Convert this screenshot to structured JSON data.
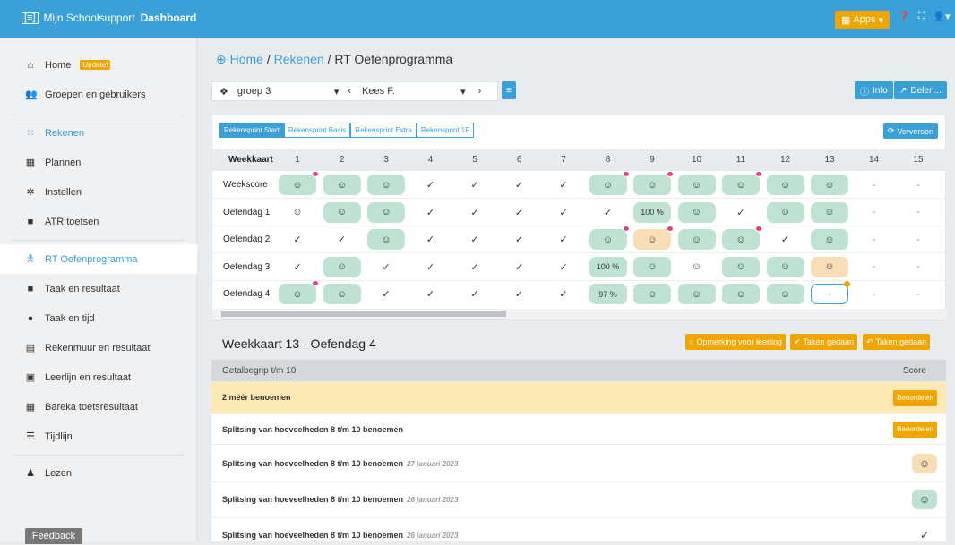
{
  "app": {
    "logo_text": "[≡]",
    "title_prefix": "Mijn Schoolsupport",
    "title_bold": "Dashboard",
    "apps_label": "Apps"
  },
  "sidebar": {
    "items": [
      {
        "label": "Home",
        "badge": "Update!",
        "icon": "home-icon"
      },
      {
        "label": "Groepen en gebruikers",
        "icon": "users-icon"
      },
      {
        "label": "Rekenen",
        "icon": "grid-dots-icon"
      },
      {
        "label": "Plannen",
        "icon": "calendar-icon"
      },
      {
        "label": "Instellen",
        "icon": "gear-icon"
      },
      {
        "label": "ATR toetsen",
        "icon": "box-icon"
      },
      {
        "label": "RT Oefenprogramma",
        "icon": "person-icon"
      },
      {
        "label": "Taak en resultaat",
        "icon": "box-icon"
      },
      {
        "label": "Taak en tijd",
        "icon": "bomb-icon"
      },
      {
        "label": "Rekenmuur en resultaat",
        "icon": "wall-icon"
      },
      {
        "label": "Leerlijn en resultaat",
        "icon": "calendar-check-icon"
      },
      {
        "label": "Bareka toetsresultaat",
        "icon": "table-icon"
      },
      {
        "label": "Tijdlijn",
        "icon": "bars-icon"
      },
      {
        "label": "Lezen",
        "icon": "reader-icon"
      }
    ],
    "feedback": "Feedback"
  },
  "breadcrumb": {
    "home": "Home",
    "sep1": "/",
    "rekenen": "Rekenen",
    "sep2": "/",
    "current": "RT Oefenprogramma"
  },
  "toolbar": {
    "group": "groep 3",
    "student": "Kees F.",
    "info": "Info",
    "share": "Delen..."
  },
  "tabs": [
    "Rekensprint Start",
    "Rekensprint Basis",
    "Rekensprint Extra",
    "Rekensprint 1F"
  ],
  "refresh_label": "Verversen",
  "grid": {
    "header_label": "Weekkaart",
    "weeks": [
      "1",
      "2",
      "3",
      "4",
      "5",
      "6",
      "7",
      "8",
      "9",
      "10",
      "11",
      "12",
      "13",
      "14",
      "15"
    ],
    "rows": [
      {
        "label": "Weekscore",
        "cells": [
          "☺g*",
          "☺g",
          "☺g",
          "✓",
          "✓",
          "✓",
          "✓",
          "☺g*",
          "☺g*",
          "☺g",
          "☺g*",
          "☺g",
          "☺g",
          "-",
          "-"
        ]
      },
      {
        "label": "Oefendag 1",
        "cells": [
          "☺",
          "☺g",
          "☺g",
          "✓",
          "✓",
          "✓",
          "✓",
          "✓",
          "100 %g",
          "☺g",
          "✓",
          "☺g",
          "☺g",
          "-",
          "-"
        ]
      },
      {
        "label": "Oefendag 2",
        "cells": [
          "✓",
          "✓",
          "☺g",
          "✓",
          "✓",
          "✓",
          "✓",
          "☺g*",
          "☺o*",
          "☺g",
          "☺g*",
          "✓",
          "☺g",
          "-",
          "-"
        ]
      },
      {
        "label": "Oefendag 3",
        "cells": [
          "✓",
          "☺g",
          "✓",
          "✓",
          "✓",
          "✓",
          "✓",
          "100 %g",
          "☺g",
          "☺",
          "☺g",
          "☺g",
          "☺o",
          "-",
          "-"
        ]
      },
      {
        "label": "Oefendag 4",
        "cells": [
          "☺g*",
          "☺g",
          "✓",
          "✓",
          "✓",
          "✓",
          "✓",
          "97 %g",
          "☺g",
          "☺g",
          "☺g",
          "☺g",
          "-b",
          "-",
          "-"
        ]
      }
    ]
  },
  "detail": {
    "title": "Weekkaart 13 - Oefendag 4",
    "btn_comment": "Opmerking voor leerling",
    "btn_done": "Taken gedaan",
    "btn_undo": "Taken gedaan",
    "col_topic": "Getalbegrip t/m 10",
    "col_score": "Score",
    "rows": [
      {
        "text": "2 méér benoemen",
        "date": "",
        "action": "Beoordelen"
      },
      {
        "text": "Splitsing van hoeveelheden 8 t/m 10 benoemen",
        "date": "",
        "action": "Beoordelen"
      },
      {
        "text": "Splitsing van hoeveelheden 8 t/m 10 benoemen",
        "date": "27 januari 2023",
        "score": "smiley-orange"
      },
      {
        "text": "Splitsing van hoeveelheden 8 t/m 10 benoemen",
        "date": "26 januari 2023",
        "score": "smiley-green"
      },
      {
        "text": "Splitsing van hoeveelheden 8 t/m 10 benoemen",
        "date": "26 januari 2023",
        "score": "check"
      }
    ]
  },
  "colors": {
    "accent": "#3aa0d8",
    "orange": "#f0a500",
    "green": "#bfe3d2",
    "peach": "#f9ddb5",
    "highlight": "#fde9b3"
  }
}
